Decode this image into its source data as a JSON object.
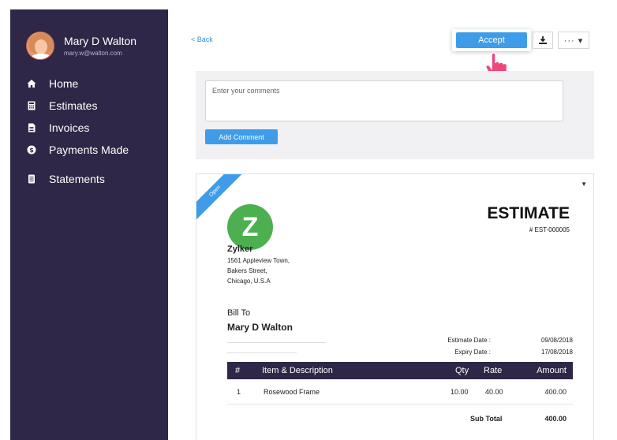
{
  "profile": {
    "name": "Mary D Walton",
    "email": "mary.w@walton.com"
  },
  "nav": {
    "items": [
      {
        "label": "Home",
        "icon": "home-icon"
      },
      {
        "label": "Estimates",
        "icon": "estimates-icon"
      },
      {
        "label": "Invoices",
        "icon": "invoice-icon"
      },
      {
        "label": "Payments Made",
        "icon": "dollar-icon"
      },
      {
        "label": "Statements",
        "icon": "statements-icon"
      }
    ]
  },
  "topbar": {
    "back_label": "< Back",
    "accept_label": "Accept",
    "more_label": "··· ▾"
  },
  "comments": {
    "placeholder": "Enter your comments",
    "add_label": "Add Comment"
  },
  "estimate": {
    "status": "Open",
    "logo_letter": "Z",
    "title": "ESTIMATE",
    "number": "# EST-000005",
    "org_name": "Zylker",
    "org_address": [
      "1561 Appleview Town,",
      "Bakers Street,",
      "Chicago, U.S.A"
    ],
    "bill_to_label": "Bill To",
    "bill_to_name": "Mary D Walton",
    "estimate_date_label": "Estimate Date :",
    "estimate_date": "09/08/2018",
    "expiry_date_label": "Expiry Date :",
    "expiry_date": "17/08/2018",
    "columns": {
      "num": "#",
      "item": "Item & Description",
      "qty": "Qty",
      "rate": "Rate",
      "amount": "Amount"
    },
    "items": [
      {
        "num": "1",
        "item": "Rosewood Frame",
        "qty": "10.00",
        "rate": "40.00",
        "amount": "400.00"
      }
    ],
    "subtotal_label": "Sub Total",
    "subtotal": "400.00"
  },
  "colors": {
    "sidebar": "#2f2747",
    "accent": "#3f9ce8",
    "logo": "#4caf50"
  }
}
